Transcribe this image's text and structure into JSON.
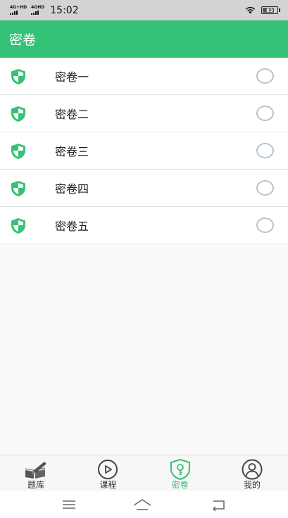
{
  "status_bar": {
    "signal1_label": "4G+HD",
    "signal2_label": "4GHD",
    "time": "15:02",
    "battery_level": "83"
  },
  "app_bar": {
    "title": "密卷"
  },
  "list": {
    "items": [
      {
        "label": "密卷一",
        "icon": "shield-icon",
        "selected": false
      },
      {
        "label": "密卷二",
        "icon": "shield-icon",
        "selected": false
      },
      {
        "label": "密卷三",
        "icon": "shield-icon",
        "selected": false
      },
      {
        "label": "密卷四",
        "icon": "shield-icon",
        "selected": false
      },
      {
        "label": "密卷五",
        "icon": "shield-icon",
        "selected": false
      }
    ]
  },
  "tab_bar": {
    "tabs": [
      {
        "label": "题库",
        "icon": "book-pen-icon",
        "active": false
      },
      {
        "label": "课程",
        "icon": "play-circle-icon",
        "active": false
      },
      {
        "label": "密卷",
        "icon": "lock-shield-icon",
        "active": true
      },
      {
        "label": "我的",
        "icon": "user-circle-icon",
        "active": false
      }
    ]
  },
  "nav_bar": {
    "buttons": [
      "menu-icon",
      "home-icon",
      "back-icon"
    ]
  },
  "colors": {
    "accent": "#34c276",
    "status_bar_bg": "#d3d3d3",
    "radio_border": "#b5c3cc"
  }
}
